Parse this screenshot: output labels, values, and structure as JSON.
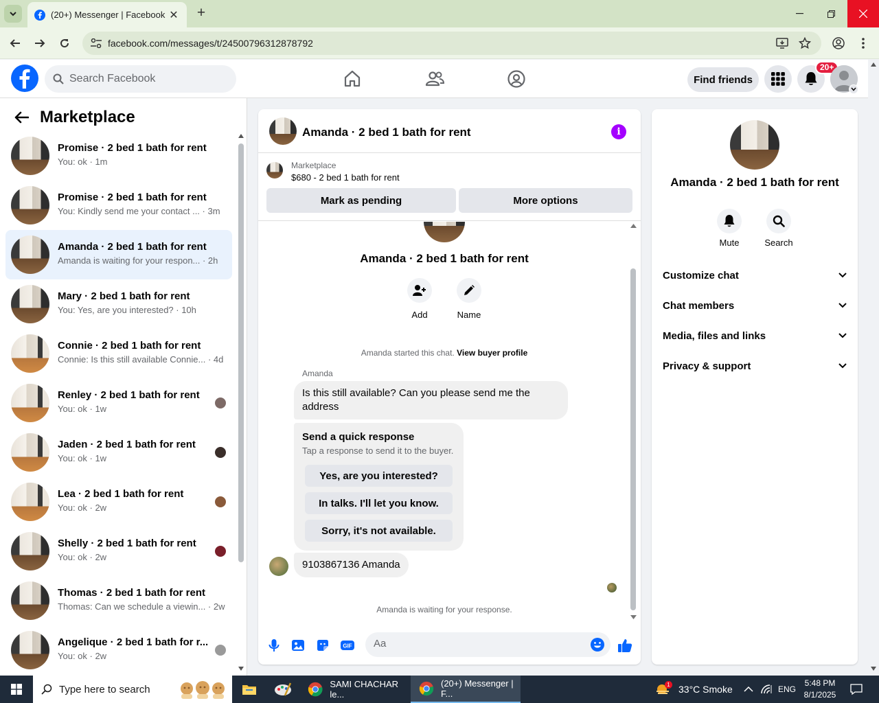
{
  "browser": {
    "tab_title": "(20+) Messenger | Facebook",
    "url": "facebook.com/messages/t/24500796312878792"
  },
  "fb": {
    "search_placeholder": "Search Facebook",
    "find_friends": "Find friends",
    "notif_badge": "20+"
  },
  "marketplace": {
    "title": "Marketplace",
    "conversations": [
      {
        "title": "Promise · 2 bed 1 bath for rent",
        "preview": "You: ok · 1m"
      },
      {
        "title": "Promise · 2 bed 1 bath for rent",
        "preview": "You: Kindly send me your contact ... · 3m"
      },
      {
        "title": "Amanda · 2 bed 1 bath for rent",
        "preview": "Amanda is waiting for your respon... · 2h"
      },
      {
        "title": "Mary · 2 bed 1 bath for rent",
        "preview": "You: Yes, are you interested? · 10h"
      },
      {
        "title": "Connie · 2 bed 1 bath for rent",
        "preview": "Connie: Is this still available Connie... · 4d"
      },
      {
        "title": "Renley · 2 bed 1 bath for rent",
        "preview": "You: ok · 1w"
      },
      {
        "title": "Jaden · 2 bed 1 bath for rent",
        "preview": "You: ok · 1w"
      },
      {
        "title": "Lea · 2 bed 1 bath for rent",
        "preview": "You: ok · 2w"
      },
      {
        "title": "Shelly · 2 bed 1 bath for rent",
        "preview": "You: ok · 2w"
      },
      {
        "title": "Thomas · 2 bed 1 bath for rent",
        "preview": "Thomas: Can we schedule a viewin... · 2w"
      },
      {
        "title": "Angelique · 2 bed 1 bath for r...",
        "preview": "You: ok · 2w"
      }
    ]
  },
  "chat": {
    "header_name": "Amanda · 2 bed 1 bath for rent",
    "listing_label": "Marketplace",
    "listing_price": "$680 - 2 bed 1 bath for rent",
    "mark_pending": "Mark as pending",
    "more_options": "More options",
    "center_name": "Amanda · 2 bed 1 bath for rent",
    "add_label": "Add",
    "name_label": "Name",
    "started_text": "Amanda started this chat.",
    "view_buyer_profile": "View buyer profile",
    "sender": "Amanda",
    "message1": "Is this still available? Can you please send me the address",
    "quick_title": "Send a quick response",
    "quick_sub": "Tap a response to send it to the buyer.",
    "quick_responses": [
      "Yes, are you interested?",
      "In talks. I'll let you know.",
      "Sorry, it's not available."
    ],
    "message2": "9103867136 Amanda",
    "waiting": "Amanda is waiting for your response.",
    "input_placeholder": "Aa"
  },
  "details": {
    "name": "Amanda · 2 bed 1 bath for rent",
    "mute": "Mute",
    "search": "Search",
    "sections": [
      "Customize chat",
      "Chat members",
      "Media, files and links",
      "Privacy & support"
    ]
  },
  "taskbar": {
    "search_placeholder": "Type here to search",
    "app1": "SAMI CHACHAR le...",
    "app2": "(20+) Messenger | F...",
    "weather": "33°C  Smoke",
    "lang": "ENG",
    "time": "5:48 PM",
    "date": "8/1/2025",
    "weather_badge": "1"
  },
  "colors": {
    "fb_blue": "#0866ff",
    "info_purple": "#a400ff",
    "badge_red": "#e41e3f"
  }
}
